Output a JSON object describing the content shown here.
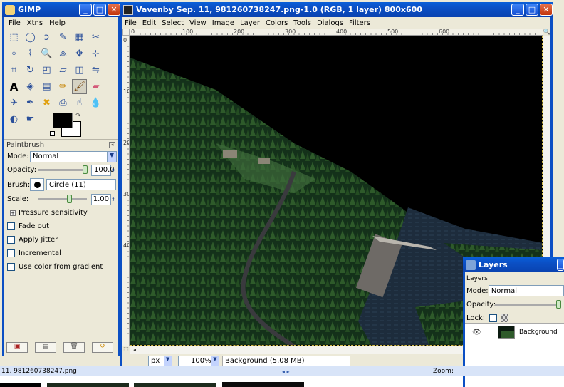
{
  "toolbox": {
    "title": "GIMP",
    "menu": [
      "File",
      "Xtns",
      "Help"
    ],
    "tool_options_title": "Paintbrush",
    "mode_label": "Mode:",
    "mode_value": "Normal",
    "opacity_label": "Opacity:",
    "opacity_value": "100.0",
    "opacity_level": 1.0,
    "brush_label": "Brush:",
    "brush_value": "Circle (11)",
    "scale_label": "Scale:",
    "scale_value": "1.00",
    "pressure_label": "Pressure sensitivity",
    "options": [
      "Fade out",
      "Apply Jitter",
      "Incremental",
      "Use color from gradient"
    ],
    "colors": {
      "fg": "#000000",
      "bg": "#ffffff"
    }
  },
  "image_window": {
    "title": "Vavenby Sep. 11, 981260738247.png-1.0 (RGB, 1 layer) 800x600",
    "menu": [
      "File",
      "Edit",
      "Select",
      "View",
      "Image",
      "Layer",
      "Colors",
      "Tools",
      "Dialogs",
      "Filters"
    ],
    "ruler_h": [
      "0",
      "100",
      "200",
      "300",
      "400",
      "500",
      "600"
    ],
    "ruler_v": [
      "0",
      "100",
      "200",
      "300",
      "400"
    ],
    "unit_value": "px",
    "zoom_value": "100%",
    "status_text": "Background (5.08 MB)"
  },
  "layers_panel": {
    "title": "Layers",
    "section_label": "Layers",
    "mode_label": "Mode:",
    "mode_value": "Normal",
    "opacity_label": "Opacity:",
    "lock_label": "Lock:",
    "layer_name": "Background"
  },
  "bottom": {
    "filename": "11, 981260738247.png",
    "zoom_label": "Zoom:"
  }
}
